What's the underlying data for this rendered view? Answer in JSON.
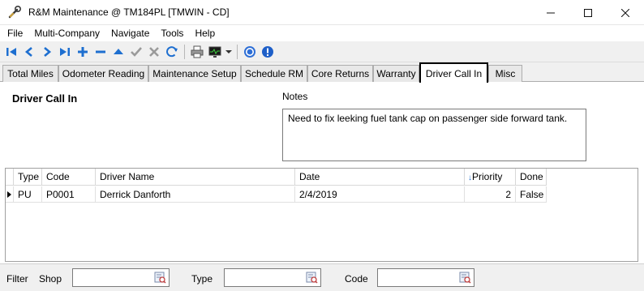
{
  "window": {
    "title": "R&M Maintenance @ TM184PL [TMWIN - CD]",
    "app_icon": "wrench-icon",
    "controls": [
      "minimize-icon",
      "maximize-icon",
      "close-icon"
    ]
  },
  "menu": [
    "File",
    "Multi-Company",
    "Navigate",
    "Tools",
    "Help"
  ],
  "toolbar": {
    "buttons": [
      "first-record-icon",
      "previous-record-icon",
      "next-record-icon",
      "last-record-icon",
      "add-icon",
      "delete-icon",
      "move-up-icon",
      "save-check-icon",
      "cancel-x-icon",
      "refresh-icon",
      "print-icon",
      "monitor-icon",
      "dropdown-arrow-icon",
      "help-icon",
      "info-icon"
    ]
  },
  "tabs": [
    "Total Miles",
    "Odometer Reading",
    "Maintenance Setup",
    "Schedule RM",
    "Core Returns",
    "Warranty",
    "Driver Call In",
    "Misc"
  ],
  "active_tab": "Driver Call In",
  "section": {
    "title": "Driver Call In",
    "notes_label": "Notes",
    "notes_value": "Need to fix leeking fuel tank cap on passenger side forward tank."
  },
  "grid": {
    "columns": [
      "Type",
      "Code",
      "Driver Name",
      "Date",
      "Priority",
      "Done"
    ],
    "sort_column": "Priority",
    "rows": [
      {
        "type": "PU",
        "code": "P0001",
        "driver_name": "Derrick Danforth",
        "date": "2/4/2019",
        "priority": "2",
        "done": "False"
      }
    ]
  },
  "filter": {
    "label": "Filter",
    "shop_label": "Shop",
    "shop_value": "",
    "type_label": "Type",
    "type_value": "",
    "code_label": "Code",
    "code_value": ""
  },
  "colors": {
    "toolbar_blue": "#1e6fd0",
    "active_tab_border": "#000000"
  }
}
